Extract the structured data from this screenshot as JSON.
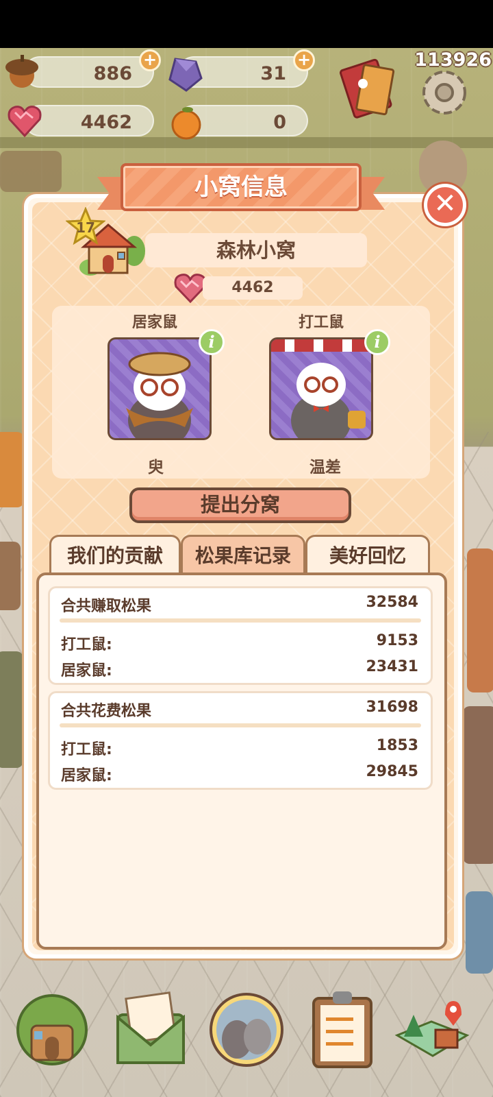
{
  "resources": {
    "acorn": {
      "value": "886",
      "icon": "acorn-icon"
    },
    "gem": {
      "value": "31",
      "icon": "purple-gem-icon"
    },
    "heart": {
      "value": "4462",
      "icon": "heart-gem-icon"
    },
    "orange": {
      "value": "0",
      "icon": "orange-icon"
    },
    "add_symbol": "+"
  },
  "score": "113926",
  "modal": {
    "title": "小窝信息",
    "close_symbol": "✕",
    "level": "17",
    "nest_name": "森林小窝",
    "heart_count": "4462",
    "members": [
      {
        "role": "居家鼠",
        "name": "臾"
      },
      {
        "role": "打工鼠",
        "name": "温差"
      }
    ],
    "info_symbol": "i",
    "split_button": "提出分窝",
    "tabs": [
      {
        "label": "我们的贡献",
        "active": false
      },
      {
        "label": "松果库记录",
        "active": true
      },
      {
        "label": "美好回忆",
        "active": false
      }
    ],
    "cards": [
      {
        "total_label": "合共赚取松果",
        "total_value": "32584",
        "rows": [
          {
            "label": "打工鼠:",
            "value": "9153"
          },
          {
            "label": "居家鼠:",
            "value": "23431"
          }
        ]
      },
      {
        "total_label": "合共花费松果",
        "total_value": "31698",
        "rows": [
          {
            "label": "打工鼠:",
            "value": "1853"
          },
          {
            "label": "居家鼠:",
            "value": "29845"
          }
        ]
      }
    ]
  },
  "bottom_nav": [
    "home-nav-icon",
    "mail-nav-icon",
    "friends-nav-icon",
    "tasks-nav-icon",
    "map-nav-icon"
  ],
  "colors": {
    "accent": "#f3986a",
    "text": "#6b4a37",
    "panel": "#fbd9b2",
    "close": "#ea6a55",
    "info": "#9ccc65"
  }
}
